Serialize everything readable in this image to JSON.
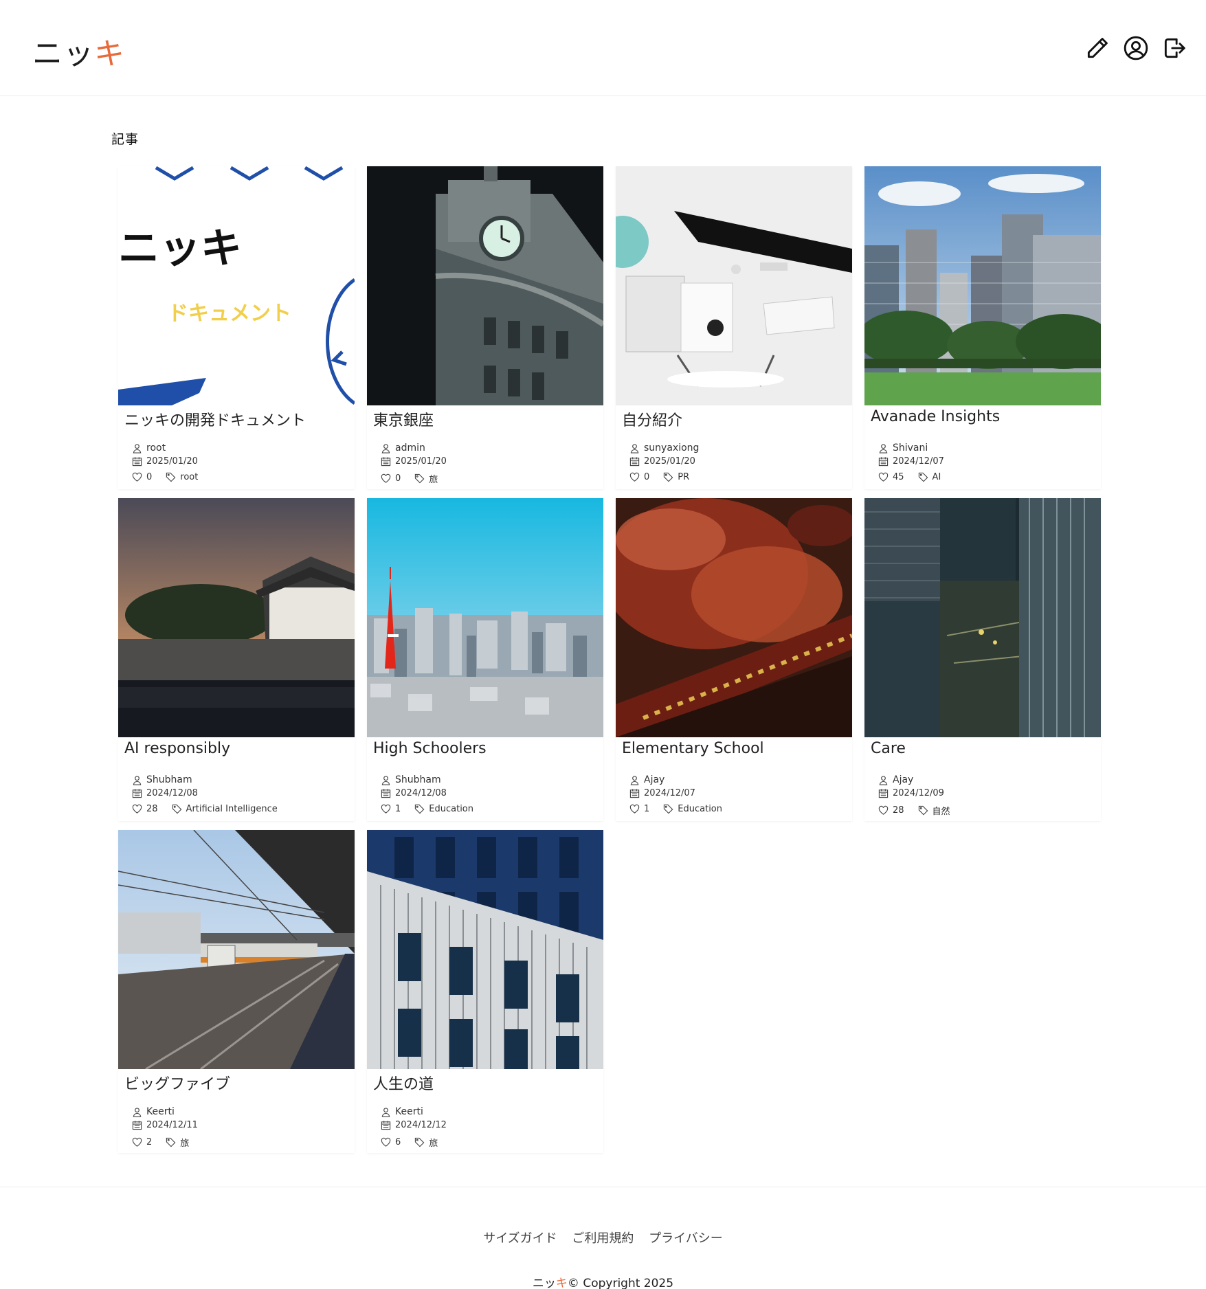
{
  "header": {
    "logo_part1": "ニッ",
    "logo_part2": "キ",
    "icons": [
      "pencil-icon",
      "account-circle-icon",
      "logout-icon"
    ]
  },
  "section": {
    "title": "記事"
  },
  "articles": [
    {
      "title": "ニッキの開発ドキュメント",
      "author": "root",
      "date": "2025/01/20",
      "likes": "0",
      "tag": "root",
      "thumb_text": "ニッキ",
      "thumb_sub": "ドキュメント"
    },
    {
      "title": "東京銀座",
      "author": "admin",
      "date": "2025/01/20",
      "likes": "0",
      "tag": "旅"
    },
    {
      "title": "自分紹介",
      "author": "sunyaxiong",
      "date": "2025/01/20",
      "likes": "0",
      "tag": "PR"
    },
    {
      "title": "Avanade Insights",
      "author": "Shivani",
      "date": "2024/12/07",
      "likes": "45",
      "tag": "AI"
    },
    {
      "title": "AI responsibly",
      "author": "Shubham",
      "date": "2024/12/08",
      "likes": "28",
      "tag": "Artificial Intelligence"
    },
    {
      "title": "High Schoolers",
      "author": "Shubham",
      "date": "2024/12/08",
      "likes": "1",
      "tag": "Education"
    },
    {
      "title": "Elementary School",
      "author": "Ajay",
      "date": "2024/12/07",
      "likes": "1",
      "tag": "Education"
    },
    {
      "title": "Care",
      "author": "Ajay",
      "date": "2024/12/09",
      "likes": "28",
      "tag": "自然"
    },
    {
      "title": "ビッグファイブ",
      "author": "Keerti",
      "date": "2024/12/11",
      "likes": "2",
      "tag": "旅"
    },
    {
      "title": "人生の道",
      "author": "Keerti",
      "date": "2024/12/12",
      "likes": "6",
      "tag": "旅"
    }
  ],
  "footer": {
    "links": [
      "サイズガイド",
      "ご利用規約",
      "プライバシー"
    ],
    "copyright_logo_part1": "ニッ",
    "copyright_logo_part2": "キ",
    "copyright_text": "© Copyright 2025"
  },
  "colors": {
    "accent": "#e86a3a",
    "doc_blue": "#1f4fa8",
    "doc_yellow": "#f2cf4a"
  }
}
